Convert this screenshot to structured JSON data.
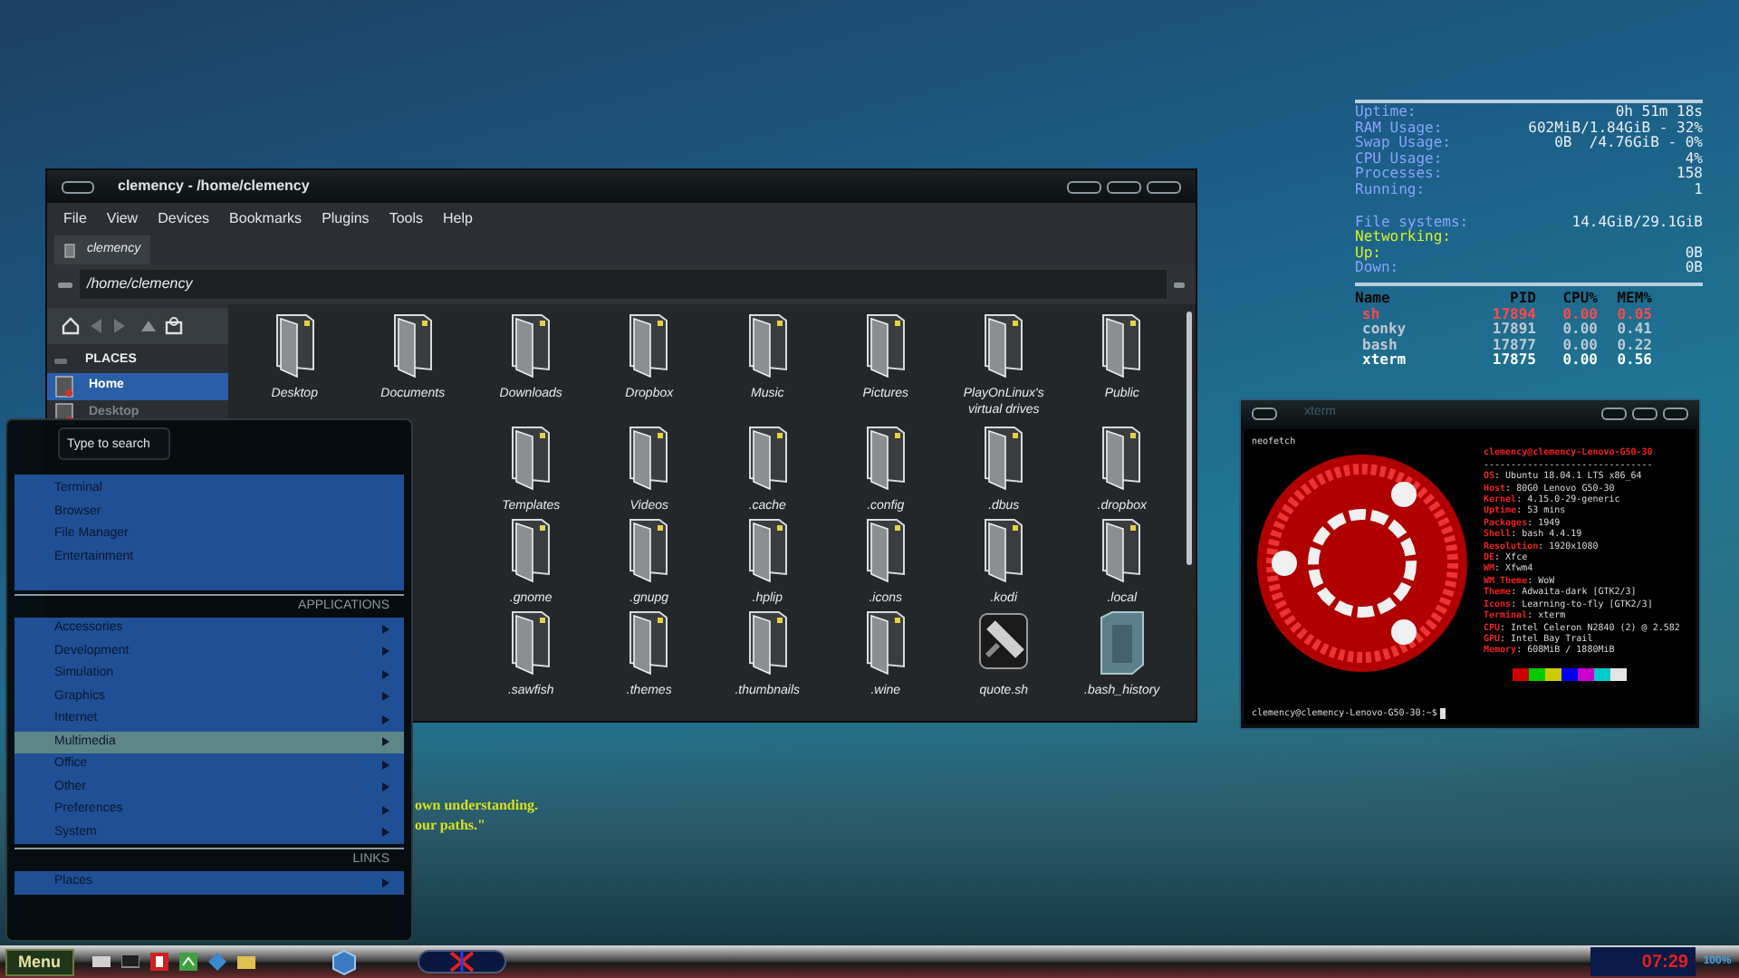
{
  "conky": {
    "groups": [
      [
        {
          "label": "Uptime:",
          "value": "0h 51m 18s",
          "color": "#8aa2ff"
        },
        {
          "label": "RAM Usage:",
          "value": "602MiB/1.84GiB - 32%",
          "color": "#8aa2ff"
        },
        {
          "label": "Swap Usage:",
          "value": "0B  /4.76GiB - 0%",
          "color": "#8aa2ff"
        },
        {
          "label": "CPU Usage:",
          "value": "4%",
          "color": "#8aa2ff"
        },
        {
          "label": "Processes:",
          "value": "158",
          "color": "#8aa2ff"
        },
        {
          "label": "Running:",
          "value": "1",
          "color": "#8aa2ff"
        }
      ],
      [
        {
          "label": "File systems:",
          "value": "14.4GiB/29.1GiB",
          "color": "#8aa2ff"
        },
        {
          "label": "Networking:",
          "color": "#d8f030"
        },
        {
          "label": "Up:",
          "value": "0B",
          "color": "#d8f030"
        },
        {
          "label": "Down:",
          "value": "0B",
          "color": "#8aa2ff"
        }
      ]
    ],
    "processes": {
      "columns": [
        "Name",
        "PID",
        "CPU%",
        "MEM%"
      ],
      "rows": [
        {
          "cells": [
            "sh",
            "17894",
            "0.00",
            "0.05"
          ],
          "color": "#ff4a4a"
        },
        {
          "cells": [
            "conky",
            "17891",
            "0.00",
            "0.41"
          ],
          "color": "#c0c8d0"
        },
        {
          "cells": [
            "bash",
            "17877",
            "0.00",
            "0.22"
          ],
          "color": "#c0c8d0"
        },
        {
          "cells": [
            "xterm",
            "17875",
            "0.00",
            "0.56"
          ],
          "color": "#ffffff"
        }
      ]
    }
  },
  "file_manager": {
    "title": "clemency - /home/clemency",
    "menu": [
      "File",
      "View",
      "Devices",
      "Bookmarks",
      "Plugins",
      "Tools",
      "Help"
    ],
    "tabs": [
      {
        "label": "clemency",
        "selected": true
      }
    ],
    "path": "/home/clemency",
    "places_header": "PLACES",
    "places": [
      {
        "label": "Home",
        "selected": true
      },
      {
        "label": "Desktop",
        "selected": false
      }
    ],
    "rows": [
      [
        {
          "label": "Desktop",
          "kind": "folder"
        },
        {
          "label": "Documents",
          "kind": "folder"
        },
        {
          "label": "Downloads",
          "kind": "folder"
        },
        {
          "label": "Dropbox",
          "kind": "folder"
        },
        {
          "label": "Music",
          "kind": "folder"
        },
        {
          "label": "Pictures",
          "kind": "folder"
        },
        {
          "label": "PlayOnLinux's virtual drives",
          "kind": "folder"
        },
        {
          "label": "Public",
          "kind": "folder"
        }
      ],
      [
        null,
        null,
        {
          "label": "Templates",
          "kind": "folder"
        },
        {
          "label": "Videos",
          "kind": "folder"
        },
        {
          "label": ".cache",
          "kind": "folder"
        },
        {
          "label": ".config",
          "kind": "folder"
        },
        {
          "label": ".dbus",
          "kind": "folder"
        },
        {
          "label": ".dropbox",
          "kind": "folder"
        }
      ],
      [
        null,
        null,
        {
          "label": ".gnome",
          "kind": "folder"
        },
        {
          "label": ".gnupg",
          "kind": "folder"
        },
        {
          "label": ".hplip",
          "kind": "folder"
        },
        {
          "label": ".icons",
          "kind": "folder"
        },
        {
          "label": ".kodi",
          "kind": "folder"
        },
        {
          "label": ".local",
          "kind": "folder"
        }
      ],
      [
        null,
        null,
        {
          "label": ".sawfish",
          "kind": "folder"
        },
        {
          "label": ".themes",
          "kind": "folder"
        },
        {
          "label": ".thumbnails",
          "kind": "folder"
        },
        {
          "label": ".wine",
          "kind": "folder"
        },
        {
          "label": "quote.sh",
          "kind": "script"
        },
        {
          "label": ".bash_history",
          "kind": "file"
        }
      ]
    ]
  },
  "xterm": {
    "title": "xterm",
    "command": "neofetch",
    "header": "clemency@clemency-Lenovo-G50-30",
    "rule": "-------------------------------",
    "info": [
      {
        "label": "OS",
        "value": ": Ubuntu 18.04.1 LTS x86_64"
      },
      {
        "label": "Host",
        "value": ": 80G0 Lenovo G50-30"
      },
      {
        "label": "Kernel",
        "value": ": 4.15.0-29-generic"
      },
      {
        "label": "Uptime",
        "value": ": 53 mins"
      },
      {
        "label": "Packages",
        "value": ": 1949"
      },
      {
        "label": "Shell",
        "value": ": bash 4.4.19"
      },
      {
        "label": "Resolution",
        "value": ": 1920x1080"
      },
      {
        "label": "DE",
        "value": ": Xfce"
      },
      {
        "label": "WM",
        "value": ": Xfwm4"
      },
      {
        "label": "WM Theme",
        "value": ": WoW"
      },
      {
        "label": "Theme",
        "value": ": Adwaita-dark [GTK2/3]"
      },
      {
        "label": "Icons",
        "value": ": Learning-to-fly [GTK2/3]"
      },
      {
        "label": "Terminal",
        "value": ": xterm"
      },
      {
        "label": "CPU",
        "value": ": Intel Celeron N2840 (2) @ 2.582"
      },
      {
        "label": "GPU",
        "value": ": Intel Bay Trail"
      },
      {
        "label": "Memory",
        "value": ": 608MiB / 1880MiB"
      }
    ],
    "palette": [
      {
        "color": "#cc0000"
      },
      {
        "color": "#00cc00"
      },
      {
        "color": "#cccc00"
      },
      {
        "color": "#0000ee"
      },
      {
        "color": "#cc00cc"
      },
      {
        "color": "#00cccc"
      },
      {
        "color": "#e5e5e5"
      }
    ],
    "prompt": "clemency@clemency-Lenovo-G50-30:~$"
  },
  "desktop_quote": [
    "own understanding.",
    "our paths.\""
  ],
  "app_menu": {
    "search": {
      "placeholder": "Type to search"
    },
    "favorites": [
      "Terminal",
      "Browser",
      "File Manager",
      "Entertainment"
    ],
    "applications_header": "APPLICATIONS",
    "applications": [
      {
        "label": "Accessories",
        "selected": false
      },
      {
        "label": "Development",
        "selected": false
      },
      {
        "label": "Simulation",
        "selected": false
      },
      {
        "label": "Graphics",
        "selected": false
      },
      {
        "label": "Internet",
        "selected": false
      },
      {
        "label": "Multimedia",
        "selected": true
      },
      {
        "label": "Office",
        "selected": false
      },
      {
        "label": "Other",
        "selected": false
      },
      {
        "label": "Preferences",
        "selected": false
      },
      {
        "label": "System",
        "selected": false
      }
    ],
    "links_header": "LINKS",
    "links": [
      {
        "label": "Places",
        "selected": false
      }
    ]
  },
  "taskbar": {
    "menu_button": "Menu",
    "clock": "07:29",
    "battery": "100%"
  }
}
